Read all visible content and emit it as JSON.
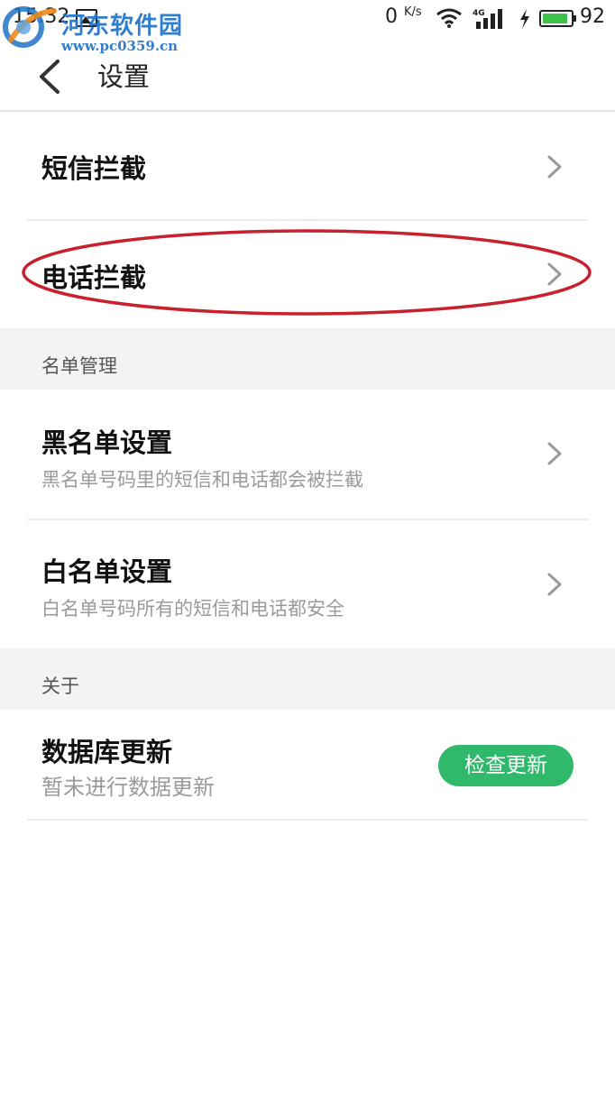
{
  "status_bar": {
    "time": "15:32",
    "net_speed": "0",
    "net_speed_unit": "K/s",
    "network_type": "4G",
    "battery_level_text": "92",
    "battery_level": 0.92
  },
  "watermark": {
    "name": "河东软件园",
    "url": "www.pc0359.cn"
  },
  "header": {
    "title": "设置"
  },
  "interception": {
    "sms_label": "短信拦截",
    "call_label": "电话拦截"
  },
  "list_management": {
    "section_label": "名单管理",
    "blacklist": {
      "title": "黑名单设置",
      "subtitle": "黑名单号码里的短信和电话都会被拦截"
    },
    "whitelist": {
      "title": "白名单设置",
      "subtitle": "白名单号码所有的短信和电话都安全"
    }
  },
  "about": {
    "section_label": "关于",
    "database": {
      "title": "数据库更新",
      "subtitle": "暂未进行数据更新",
      "button_label": "检查更新"
    }
  },
  "colors": {
    "accent_green": "#31b96b",
    "highlight_red": "#c8202c",
    "watermark_blue": "#1f74c8"
  }
}
